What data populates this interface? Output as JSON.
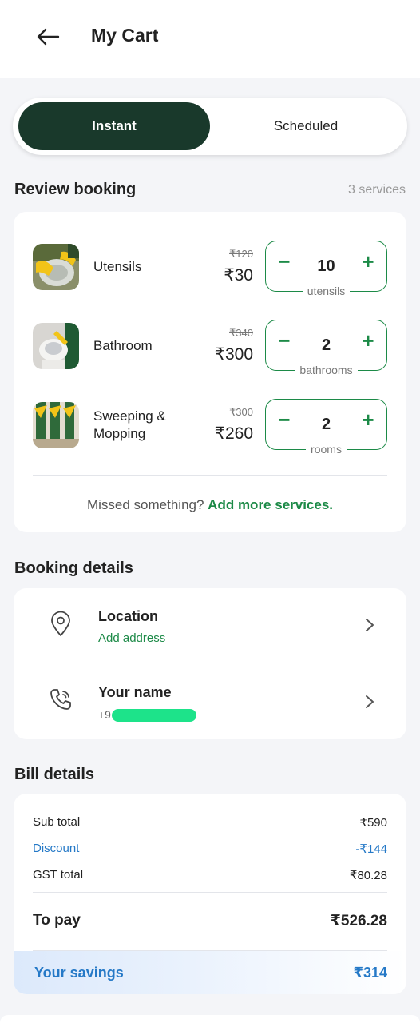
{
  "header": {
    "title": "My Cart"
  },
  "tabs": [
    {
      "label": "Instant",
      "selected": true
    },
    {
      "label": "Scheduled",
      "selected": false
    }
  ],
  "review": {
    "title": "Review booking",
    "count": "3 services",
    "services": [
      {
        "name": "Utensils",
        "old_price": "₹120",
        "price": "₹30",
        "qty": "10",
        "unit": "utensils",
        "thumb": "utensils-photo"
      },
      {
        "name": "Bathroom",
        "old_price": "₹340",
        "price": "₹300",
        "qty": "2",
        "unit": "bathrooms",
        "thumb": "bathroom-photo"
      },
      {
        "name": "Sweeping & Mopping",
        "old_price": "₹300",
        "price": "₹260",
        "qty": "2",
        "unit": "rooms",
        "thumb": "sweeping-photo"
      }
    ],
    "missed_prefix": "Missed something?",
    "missed_link": "Add more services."
  },
  "booking_details": {
    "title": "Booking details",
    "location": {
      "title": "Location",
      "sub": "Add address",
      "icon": "location-pin-icon"
    },
    "contact": {
      "title": "Your name",
      "phone_prefix": "+9",
      "icon": "phone-icon"
    }
  },
  "bill": {
    "title": "Bill details",
    "rows": [
      {
        "label": "Sub total",
        "value": "₹590"
      },
      {
        "label": "Discount",
        "value": "-₹144"
      },
      {
        "label": "GST total",
        "value": "₹80.28"
      }
    ],
    "to_pay_label": "To pay",
    "to_pay_value": "₹526.28",
    "savings_label": "Your savings",
    "savings_value": "₹314"
  },
  "colors": {
    "primary_dark": "#19392b",
    "accent_green": "#1c8a47",
    "savings_blue": "#2579c7",
    "redaction_green": "#1de38a"
  }
}
